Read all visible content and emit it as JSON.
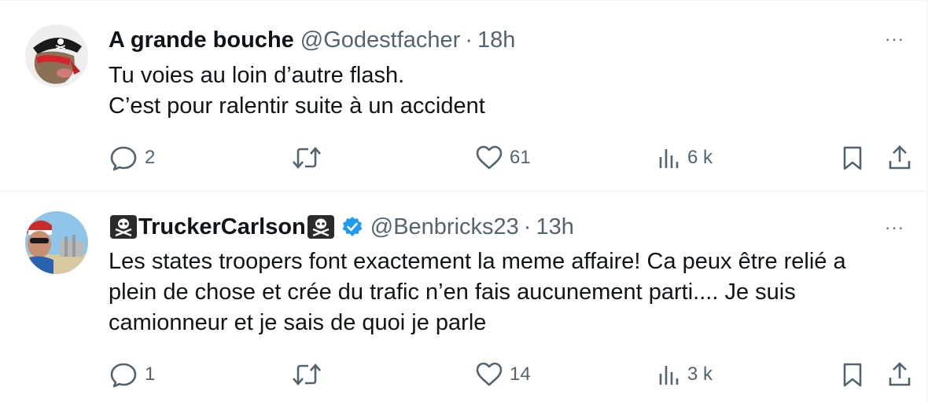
{
  "tweets": [
    {
      "display_name": "A grande bouche",
      "handle": "@Godestfacher",
      "separator": "·",
      "time": "18h",
      "more": "···",
      "lines": [
        "Tu voies au loin d’autre flash.",
        "C’est pour ralentir suite à un accident"
      ],
      "replies": "2",
      "retweets": "",
      "likes": "61",
      "views": "6 k",
      "verified": false,
      "avatar_icon": "pirate-cat-avatar"
    },
    {
      "display_name": "TruckerCarlson",
      "handle": "@Benbricks23",
      "separator": "·",
      "time": "13h",
      "more": "···",
      "lines": [
        "Les states troopers font exactement la meme affaire! Ca peux être relié a plein de chose et crée du trafic n’en fais aucunement parti.... Je suis camionneur et je sais de quoi je parle"
      ],
      "replies": "1",
      "retweets": "",
      "likes": "14",
      "views": "3 k",
      "verified": true,
      "name_emoji": "skull-crossbones-flag-icon",
      "avatar_icon": "trucker-selfie-avatar"
    }
  ],
  "colors": {
    "text": "#0f1419",
    "secondary": "#536471",
    "divider": "#eff3f4",
    "verified": "#1d9bf0"
  }
}
